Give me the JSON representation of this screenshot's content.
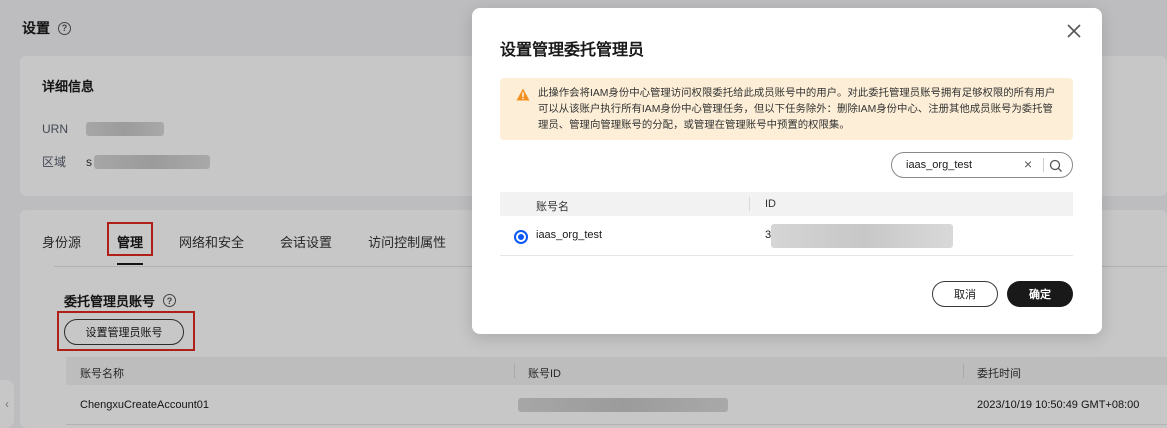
{
  "page": {
    "title": "设置",
    "help_icon": "help-circle-icon"
  },
  "detail": {
    "title": "详细信息",
    "urn_label": "URN",
    "region_label": "区域",
    "region_value_visible": "s"
  },
  "tabs": [
    {
      "label": "身份源"
    },
    {
      "label": "管理"
    },
    {
      "label": "网络和安全"
    },
    {
      "label": "会话设置"
    },
    {
      "label": "访问控制属性"
    }
  ],
  "delegated": {
    "title": "委托管理员账号",
    "set_button": "设置管理员账号",
    "columns": [
      "账号名称",
      "账号ID",
      "委托时间"
    ],
    "rows": [
      {
        "name": "ChengxuCreateAccount01",
        "id": "",
        "time": "2023/10/19 10:50:49 GMT+08:00"
      }
    ]
  },
  "dialog": {
    "title": "设置管理委托管理员",
    "close_icon": "close-icon",
    "warning": "此操作会将IAM身份中心管理访问权限委托给此成员账号中的用户。对此委托管理员账号拥有足够权限的所有用户可以从该账户执行所有IAM身份中心管理任务，但以下任务除外：删除IAM身份中心、注册其他成员账号为委托管理员、管理向管理账号的分配，或管理在管理账号中预置的权限集。",
    "search_value": "iaas_org_test",
    "columns": [
      "账号名",
      "ID"
    ],
    "rows": [
      {
        "name": "iaas_org_test",
        "id_visible": "3",
        "selected": true
      }
    ],
    "cancel": "取消",
    "ok": "确定"
  },
  "colors": {
    "accent": "#0a59f7",
    "highlight": "#e0281e",
    "warning_bg": "#fdefd7",
    "warning_icon": "#f28f1e"
  }
}
